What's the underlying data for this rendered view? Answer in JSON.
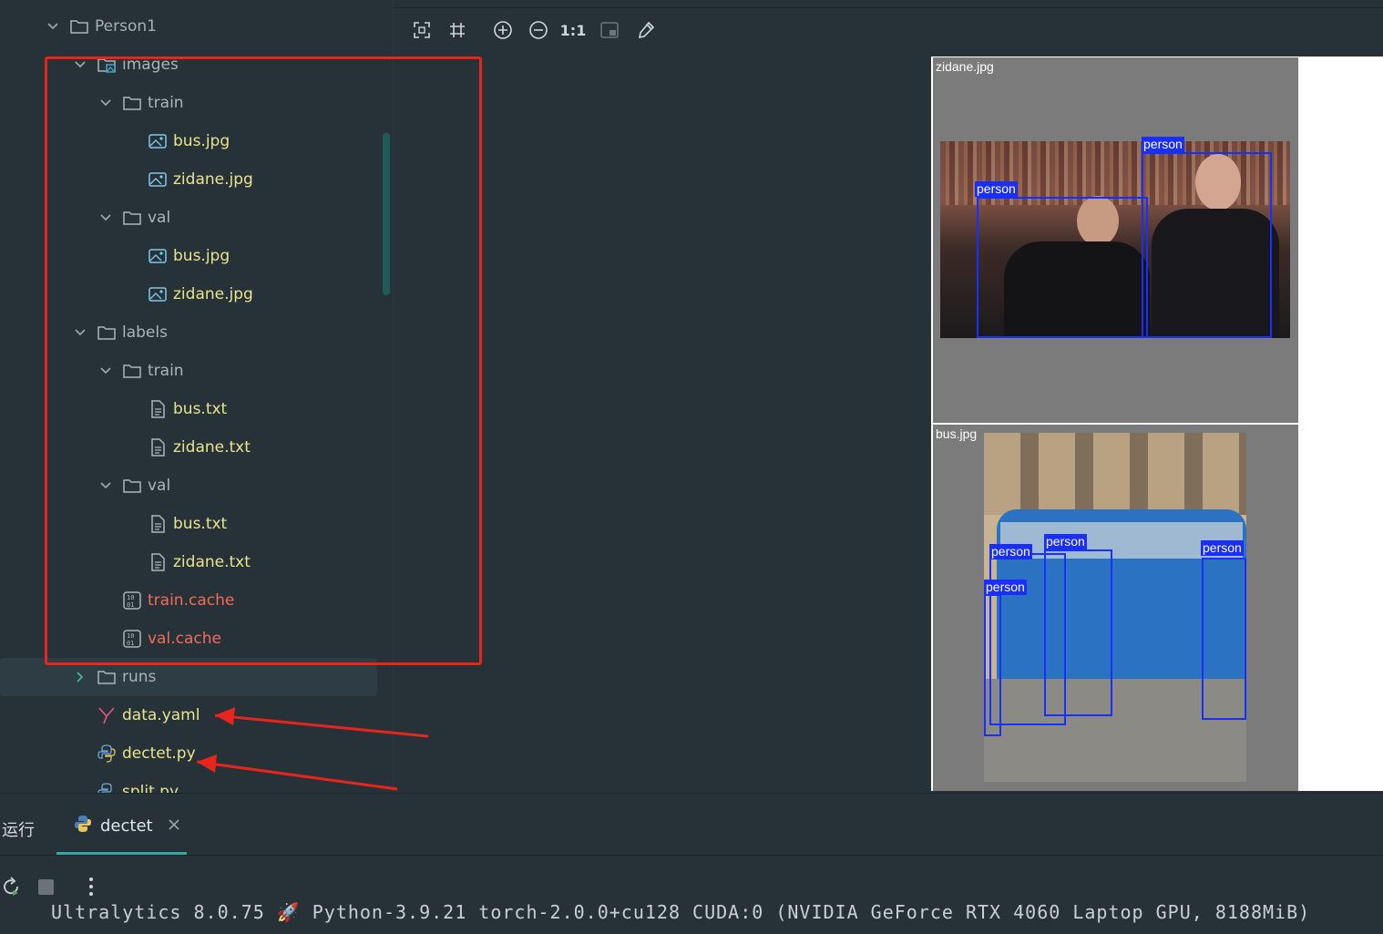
{
  "tree": {
    "items": [
      {
        "label": "Person1",
        "kind": "folder",
        "expanded": true
      },
      {
        "label": "images",
        "kind": "image-folder",
        "expanded": true
      },
      {
        "label": "train",
        "kind": "folder",
        "expanded": true
      },
      {
        "label": "bus.jpg",
        "kind": "image"
      },
      {
        "label": "zidane.jpg",
        "kind": "image"
      },
      {
        "label": "val",
        "kind": "folder",
        "expanded": true
      },
      {
        "label": "bus.jpg",
        "kind": "image"
      },
      {
        "label": "zidane.jpg",
        "kind": "image"
      },
      {
        "label": "labels",
        "kind": "folder",
        "expanded": true
      },
      {
        "label": "train",
        "kind": "folder",
        "expanded": true
      },
      {
        "label": "bus.txt",
        "kind": "text"
      },
      {
        "label": "zidane.txt",
        "kind": "text"
      },
      {
        "label": "val",
        "kind": "folder",
        "expanded": true
      },
      {
        "label": "bus.txt",
        "kind": "text"
      },
      {
        "label": "zidane.txt",
        "kind": "text"
      },
      {
        "label": "train.cache",
        "kind": "binary"
      },
      {
        "label": "val.cache",
        "kind": "binary"
      },
      {
        "label": "runs",
        "kind": "folder",
        "expanded": false
      },
      {
        "label": "data.yaml",
        "kind": "yaml"
      },
      {
        "label": "dectet.py",
        "kind": "python"
      },
      {
        "label": "split.py",
        "kind": "python"
      }
    ]
  },
  "toolbar": {
    "actual_size_label": "1:1",
    "icons": [
      "fit-to-window-icon",
      "grid-icon",
      "zoom-in-icon",
      "zoom-out-icon",
      "actual-size-icon",
      "background-icon",
      "color-picker-icon"
    ]
  },
  "viewer": {
    "panels": [
      {
        "title": "zidane.jpg",
        "detections": [
          "person",
          "person"
        ]
      },
      {
        "title": "bus.jpg",
        "detections": [
          "person",
          "person",
          "person",
          "person"
        ]
      }
    ]
  },
  "run": {
    "title": "运行",
    "tab_label": "dectet",
    "console_line": "Ultralytics 8.0.75 🚀 Python-3.9.21 torch-2.0.0+cu128 CUDA:0 (NVIDIA GeForce RTX 4060 Laptop GPU, 8188MiB)"
  },
  "colors": {
    "background": "#263238",
    "highlight": "#e8251c",
    "detection_box": "#1530ff",
    "accent_tab": "#33a6a8"
  }
}
